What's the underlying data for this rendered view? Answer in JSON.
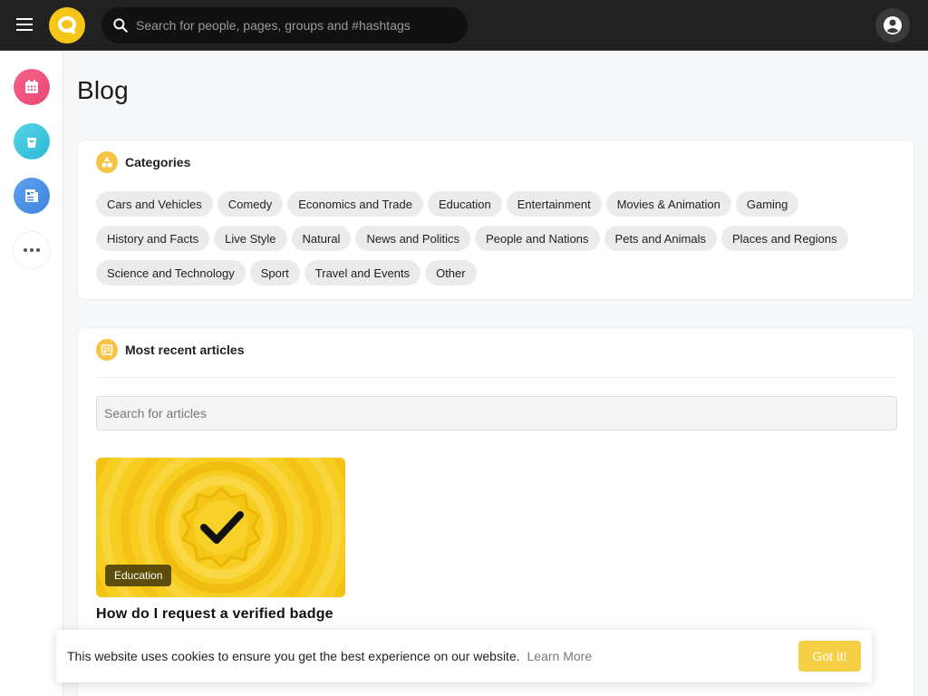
{
  "header": {
    "search_placeholder": "Search for people, pages, groups and #hashtags"
  },
  "page": {
    "title": "Blog"
  },
  "categories_card": {
    "title": "Categories",
    "chips": [
      "Cars and Vehicles",
      "Comedy",
      "Economics and Trade",
      "Education",
      "Entertainment",
      "Movies & Animation",
      "Gaming",
      "History and Facts",
      "Live Style",
      "Natural",
      "News and Politics",
      "People and Nations",
      "Pets and Animals",
      "Places and Regions",
      "Science and Technology",
      "Sport",
      "Travel and Events",
      "Other"
    ]
  },
  "articles_card": {
    "title": "Most recent articles",
    "search_placeholder": "Search for articles",
    "articles": [
      {
        "category": "Education",
        "title": "How do I request a verified badge"
      }
    ]
  },
  "cookie": {
    "text": "This website uses cookies to ensure you get the best experience on our website.",
    "link": "Learn More",
    "button": "Got It!"
  },
  "colors": {
    "topbar": "#212121",
    "accent": "#f5c518",
    "events": "#f7618b",
    "market": "#2bb8d3",
    "blogs": "#3d84dc"
  },
  "icons": {
    "menu": "menu-icon",
    "logo": "logo-icon",
    "search": "search-icon",
    "account": "account-circle-icon",
    "events": "calendar-icon",
    "market": "shopping-bag-icon",
    "blogs": "article-icon",
    "more": "more-horizontal-icon",
    "categories": "shapes-icon",
    "articles": "newspaper-icon",
    "verified": "checkmark-icon"
  }
}
